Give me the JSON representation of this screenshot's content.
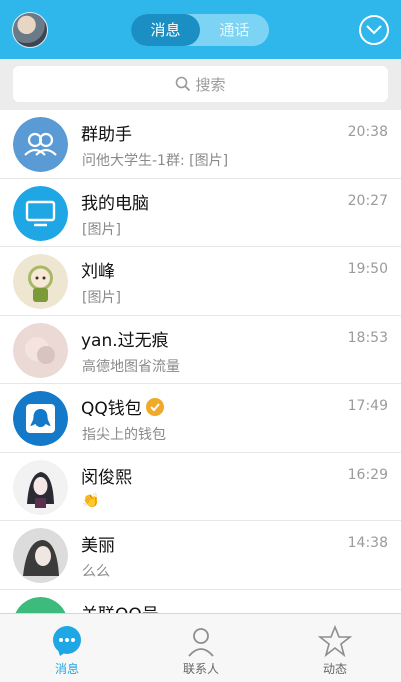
{
  "header": {
    "tabs": [
      {
        "label": "消息",
        "active": true
      },
      {
        "label": "通话",
        "active": false
      }
    ],
    "accent_color": "#2fb6ea"
  },
  "search": {
    "placeholder": "搜索"
  },
  "conversations": [
    {
      "name": "群助手",
      "message": "问他大学生-1群: [图片]",
      "time": "20:38",
      "avatar": "group-icon"
    },
    {
      "name": "我的电脑",
      "message": "[图片]",
      "time": "20:27",
      "avatar": "computer-icon"
    },
    {
      "name": "刘峰",
      "message": "[图片]",
      "time": "19:50",
      "avatar": "cartoon-avatar"
    },
    {
      "name": "yan.过无痕",
      "message": "高德地图省流量",
      "time": "18:53",
      "avatar": "photo-avatar"
    },
    {
      "name": "QQ钱包",
      "message": "指尖上的钱包",
      "time": "17:49",
      "avatar": "wallet-icon",
      "verified": true
    },
    {
      "name": "闵俊熙",
      "message": "👏",
      "time": "16:29",
      "avatar": "anime-avatar"
    },
    {
      "name": "美丽",
      "message": "么么",
      "time": "14:38",
      "avatar": "photo-avatar"
    },
    {
      "name": "关联QQ号",
      "message": "",
      "time": "",
      "avatar": "link-icon"
    }
  ],
  "tabbar": [
    {
      "label": "消息",
      "active": true,
      "icon": "chat-bubble-icon"
    },
    {
      "label": "联系人",
      "active": false,
      "icon": "contact-icon"
    },
    {
      "label": "动态",
      "active": false,
      "icon": "star-icon"
    }
  ]
}
